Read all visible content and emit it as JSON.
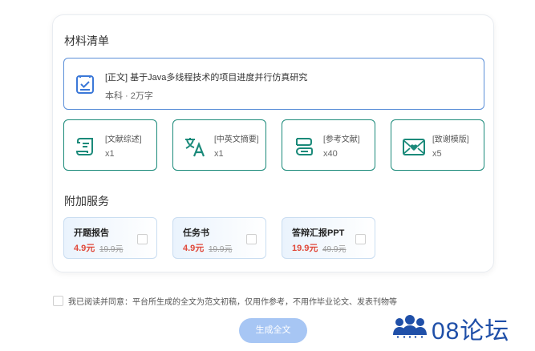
{
  "materials": {
    "title": "材料清单",
    "main": {
      "title": "[正文] 基于Java多线程技术的项目进度并行仿真研究",
      "meta": "本科 · 2万字",
      "icon": "document-check-icon"
    },
    "tiles": [
      {
        "name": "[文献综述]",
        "count": "x1",
        "icon": "scroll-icon"
      },
      {
        "name": "[中英文摘要]",
        "count": "x1",
        "icon": "translate-icon"
      },
      {
        "name": "[参考文献]",
        "count": "x40",
        "icon": "bookmark-book-icon"
      },
      {
        "name": "[致谢模版]",
        "count": "x5",
        "icon": "heart-envelope-icon"
      }
    ]
  },
  "services": {
    "title": "附加服务",
    "items": [
      {
        "name": "开题报告",
        "price": "4.9元",
        "original": "19.9元"
      },
      {
        "name": "任务书",
        "price": "4.9元",
        "original": "19.9元"
      },
      {
        "name": "答辩汇报PPT",
        "price": "19.9元",
        "original": "49.9元"
      }
    ]
  },
  "agreement": {
    "text": "我已阅读并同意：平台所生成的全文为范文初稿，仅用作参考，不用作毕业论文、发表刊物等"
  },
  "generate_label": "生成全文",
  "watermark": {
    "text": "08论坛"
  },
  "colors": {
    "accent_teal": "#1b8a7a",
    "accent_blue": "#5b8fd8",
    "price_red": "#e0483a",
    "button_blue": "#a7c6f4"
  }
}
